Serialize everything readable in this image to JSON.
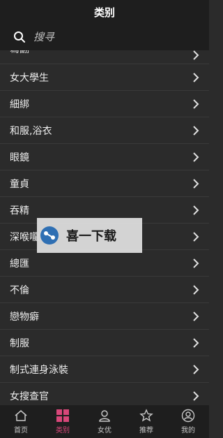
{
  "header": {
    "title": "类别"
  },
  "search": {
    "placeholder": "搜寻"
  },
  "categories": [
    "寫翻",
    "女大學生",
    "細綁",
    "和服,浴衣",
    "眼鏡",
    "童貞",
    "吞精",
    "深喉嚨",
    "總匯",
    "不倫",
    "戀物癖",
    "制服",
    "制式連身泳裝",
    "女搜查官"
  ],
  "overlay": {
    "text": "喜一下载"
  },
  "tabbar": {
    "tabs": [
      {
        "label": "首页",
        "icon": "home-icon"
      },
      {
        "label": "类别",
        "icon": "grid-icon"
      },
      {
        "label": "女优",
        "icon": "person-icon"
      },
      {
        "label": "推荐",
        "icon": "star-icon"
      },
      {
        "label": "我的",
        "icon": "profile-icon"
      }
    ],
    "active_index": 1,
    "active_color": "#d9477a"
  }
}
